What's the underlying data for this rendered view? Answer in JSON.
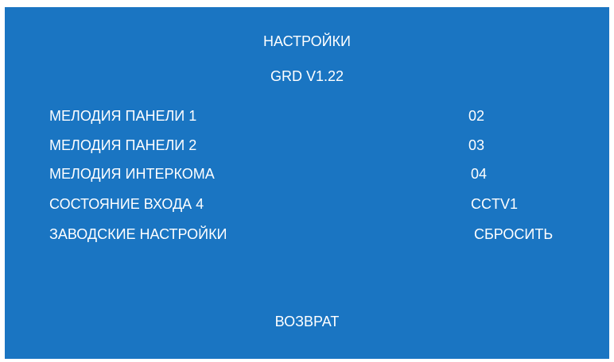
{
  "menu": {
    "title": "НАСТРОЙКИ",
    "version": "GRD V1.22",
    "items": [
      {
        "label": "МЕЛОДИЯ ПАНЕЛИ 1",
        "value": "02"
      },
      {
        "label": "МЕЛОДИЯ ПАНЕЛИ 2",
        "value": "03"
      },
      {
        "label": "МЕЛОДИЯ ИНТЕРКОМА",
        "value": "04"
      },
      {
        "label": "СОСТОЯНИЕ ВХОДА 4",
        "value": "CCTV1"
      },
      {
        "label": "ЗАВОДСКИЕ НАСТРОЙКИ",
        "value": "СБРОСИТЬ"
      }
    ],
    "back_label": "ВОЗВРАТ"
  },
  "colors": {
    "background": "#1a75c2",
    "text": "#ffffff"
  }
}
